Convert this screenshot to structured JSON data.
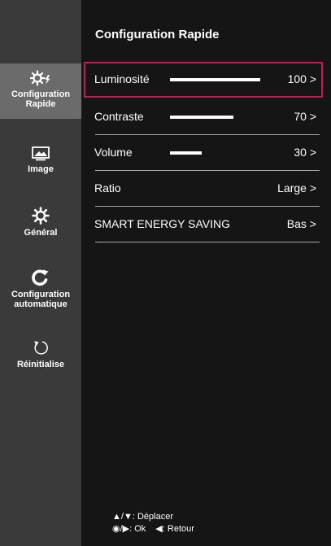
{
  "header": {
    "title": "Configuration Rapide"
  },
  "sidebar": {
    "items": [
      {
        "line1": "Configuration",
        "line2": "Rapide",
        "icon": "quick-settings-icon",
        "active": true
      },
      {
        "line1": "Image",
        "line2": "",
        "icon": "picture-icon",
        "active": false
      },
      {
        "line1": "Général",
        "line2": "",
        "icon": "gear-icon",
        "active": false
      },
      {
        "line1": "Configuration",
        "line2": "automatique",
        "icon": "auto-config-icon",
        "active": false
      },
      {
        "line1": "Réinitialise",
        "line2": "",
        "icon": "reset-icon",
        "active": false
      }
    ]
  },
  "menu": {
    "rows": [
      {
        "label": "Luminosité",
        "value": "100 >",
        "level": 1.0,
        "selected": true
      },
      {
        "label": "Contraste",
        "value": "70 >",
        "level": 0.7,
        "selected": false
      },
      {
        "label": "Volume",
        "value": "30 >",
        "level": 0.3,
        "selected": false
      },
      {
        "label": "Ratio",
        "value": "Large >",
        "selected": false
      },
      {
        "label": "SMART ENERGY SAVING",
        "value": "Bas >",
        "selected": false
      }
    ]
  },
  "footer": {
    "move_keys": "▲/▼",
    "move_label": ": Déplacer",
    "ok_keys": "◉/▶",
    "ok_label": ": Ok",
    "back_key": "◀",
    "back_label": ": Retour"
  },
  "colors": {
    "background": "#151515",
    "sidebar": "#3a3a3a",
    "active_item": "#6b6b6b",
    "selection_border": "#c8185a",
    "text": "#ffffff"
  }
}
